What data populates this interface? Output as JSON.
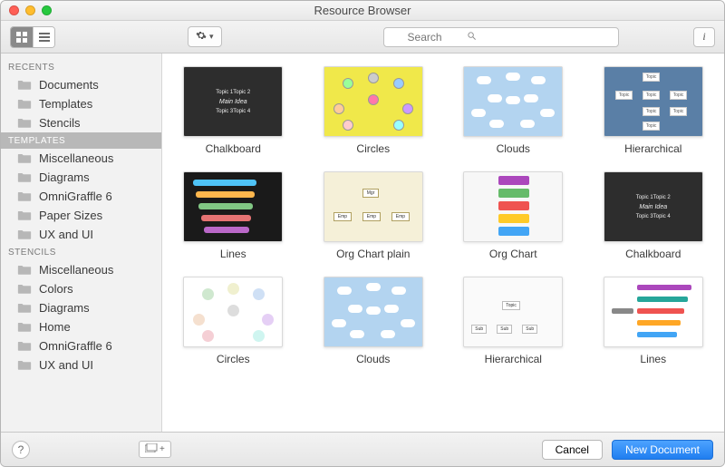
{
  "window": {
    "title": "Resource Browser"
  },
  "search": {
    "placeholder": "Search",
    "value": ""
  },
  "sidebar": {
    "sections": [
      {
        "header": "RECENTS",
        "selected": false,
        "items": [
          {
            "label": "Documents"
          },
          {
            "label": "Templates"
          },
          {
            "label": "Stencils"
          }
        ]
      },
      {
        "header": "TEMPLATES",
        "selected": true,
        "items": [
          {
            "label": "Miscellaneous"
          },
          {
            "label": "Diagrams"
          },
          {
            "label": "OmniGraffle 6"
          },
          {
            "label": "Paper Sizes"
          },
          {
            "label": "UX and UI"
          }
        ]
      },
      {
        "header": "STENCILS",
        "selected": false,
        "items": [
          {
            "label": "Miscellaneous"
          },
          {
            "label": "Colors"
          },
          {
            "label": "Diagrams"
          },
          {
            "label": "Home"
          },
          {
            "label": "OmniGraffle 6"
          },
          {
            "label": "UX and UI"
          }
        ]
      }
    ]
  },
  "templates": [
    {
      "label": "Chalkboard",
      "thumb": "chalk"
    },
    {
      "label": "Circles",
      "thumb": "circles-yellow"
    },
    {
      "label": "Clouds",
      "thumb": "clouds"
    },
    {
      "label": "Hierarchical",
      "thumb": "hier-blue"
    },
    {
      "label": "Lines",
      "thumb": "lines-dark"
    },
    {
      "label": "Org Chart plain",
      "thumb": "org-plain"
    },
    {
      "label": "Org Chart",
      "thumb": "org-color"
    },
    {
      "label": "Chalkboard",
      "thumb": "chalk"
    },
    {
      "label": "Circles",
      "thumb": "circles-white"
    },
    {
      "label": "Clouds",
      "thumb": "clouds"
    },
    {
      "label": "Hierarchical",
      "thumb": "hier-white"
    },
    {
      "label": "Lines",
      "thumb": "lines-white"
    }
  ],
  "footer": {
    "cancel": "Cancel",
    "primary": "New Document"
  },
  "toolbar": {
    "view": "grid"
  }
}
